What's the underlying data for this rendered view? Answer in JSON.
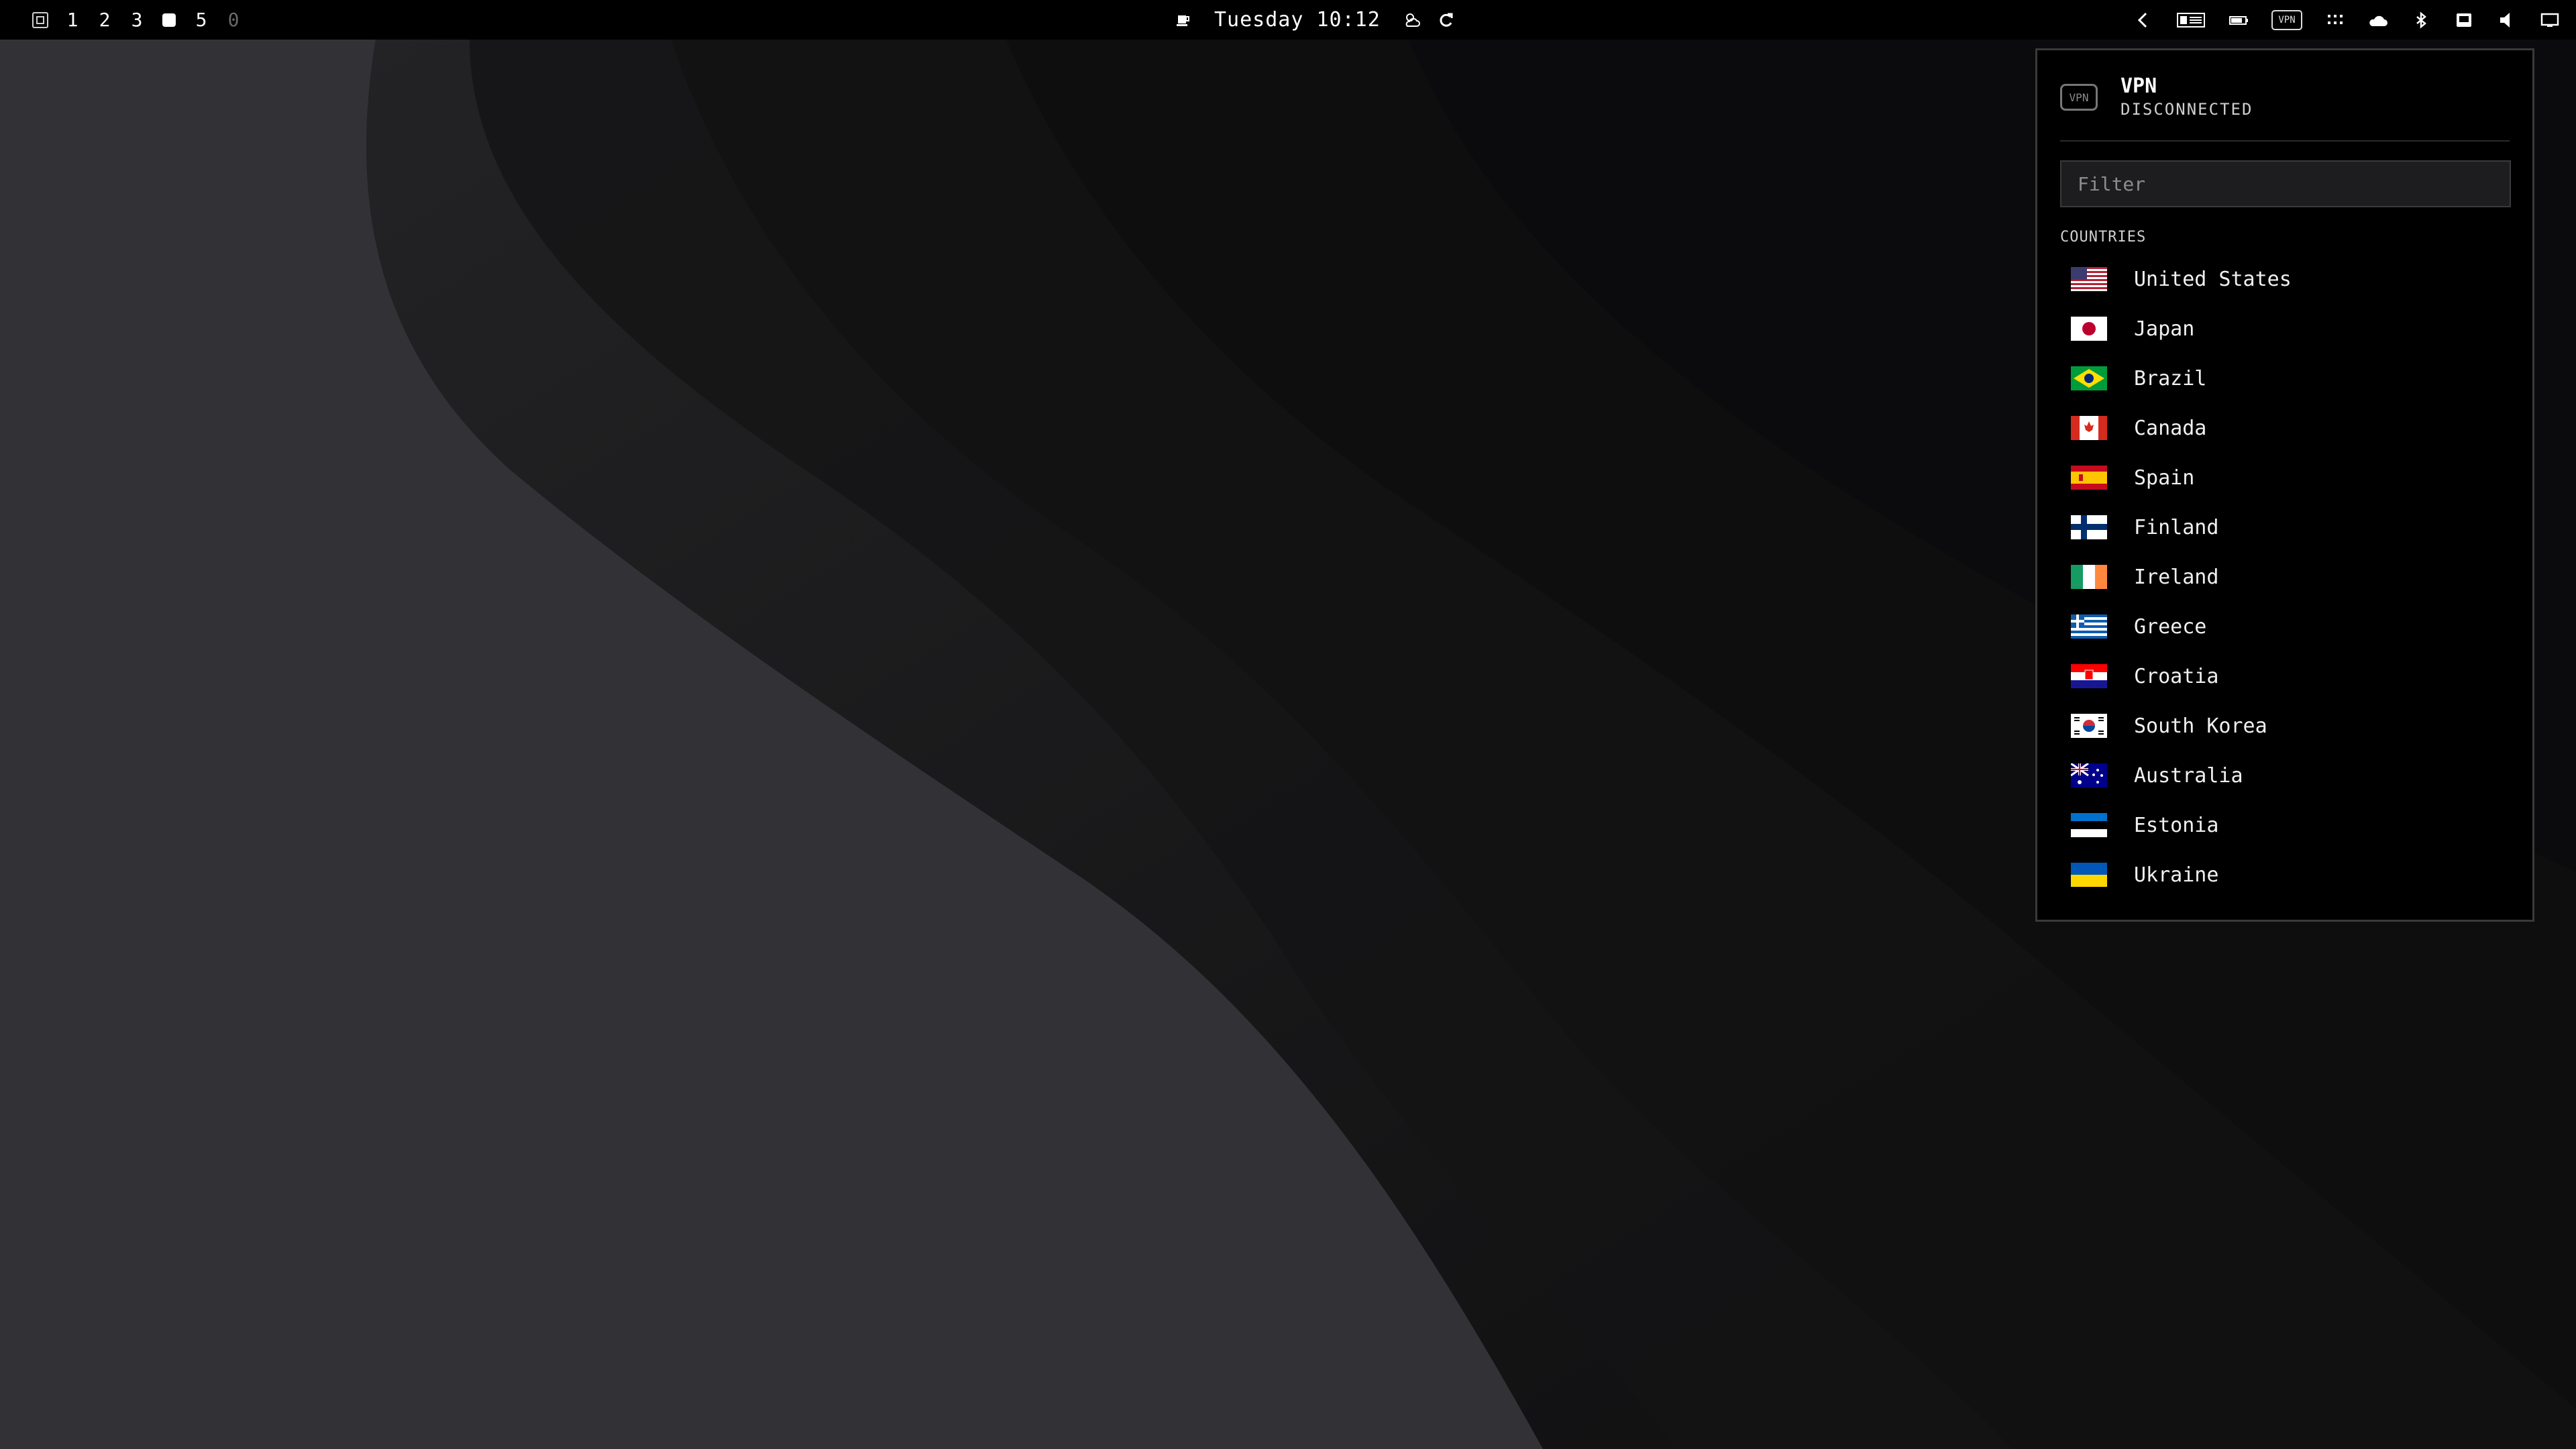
{
  "topbar": {
    "workspaces": [
      {
        "label": "",
        "kind": "overview-icon"
      },
      {
        "label": "1",
        "kind": "text"
      },
      {
        "label": "2",
        "kind": "text"
      },
      {
        "label": "3",
        "kind": "text"
      },
      {
        "label": "",
        "kind": "active-square"
      },
      {
        "label": "5",
        "kind": "text"
      },
      {
        "label": "0",
        "kind": "dim"
      }
    ],
    "clock": "Tuesday 10:12",
    "tray_icons": [
      "chevron-left-icon",
      "keyboard-layout-icon",
      "battery-icon",
      "vpn-icon",
      "apps-grid-icon",
      "cloud-icon",
      "bluetooth-icon",
      "screenshot-icon",
      "volume-icon",
      "display-icon"
    ],
    "vpn_tray_label": "VPN"
  },
  "vpn_popup": {
    "badge": "VPN",
    "title": "VPN",
    "status": "DISCONNECTED",
    "filter_placeholder": "Filter",
    "section_label": "COUNTRIES",
    "countries": [
      {
        "name": "United States",
        "flag": "us"
      },
      {
        "name": "Japan",
        "flag": "jp"
      },
      {
        "name": "Brazil",
        "flag": "br"
      },
      {
        "name": "Canada",
        "flag": "ca"
      },
      {
        "name": "Spain",
        "flag": "es"
      },
      {
        "name": "Finland",
        "flag": "fi"
      },
      {
        "name": "Ireland",
        "flag": "ie"
      },
      {
        "name": "Greece",
        "flag": "gr"
      },
      {
        "name": "Croatia",
        "flag": "hr"
      },
      {
        "name": "South Korea",
        "flag": "kr"
      },
      {
        "name": "Australia",
        "flag": "au"
      },
      {
        "name": "Estonia",
        "flag": "ee"
      },
      {
        "name": "Ukraine",
        "flag": "ua"
      }
    ]
  },
  "colors": {
    "bar_bg": "#000000",
    "popup_bg": "#000000",
    "popup_border": "#3a3a3a",
    "wallpaper_base": "#1b1b1d",
    "wallpaper_light": "#323236"
  }
}
